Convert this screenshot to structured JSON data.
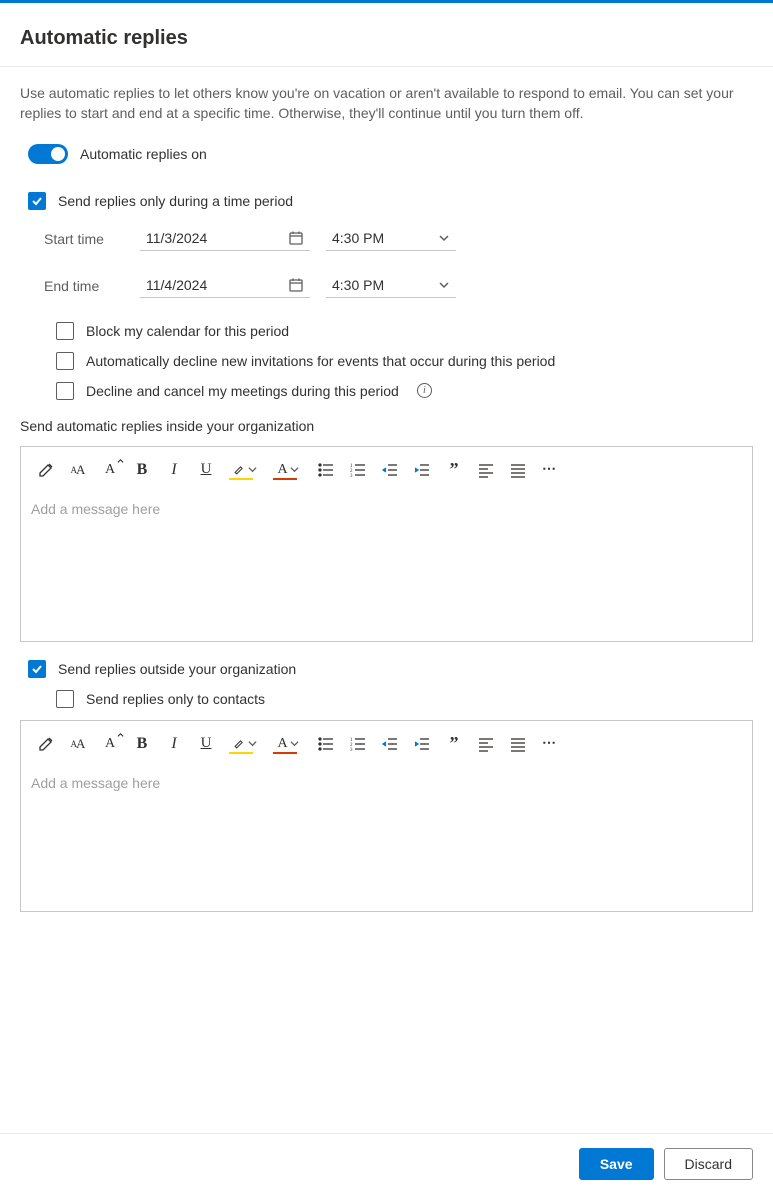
{
  "title": "Automatic replies",
  "description": "Use automatic replies to let others know you're on vacation or aren't available to respond to email. You can set your replies to start and end at a specific time. Otherwise, they'll continue until you turn them off.",
  "toggle": {
    "label": "Automatic replies on",
    "on": true
  },
  "timePeriod": {
    "sendOnlyPeriod": {
      "label": "Send replies only during a time period",
      "checked": true
    },
    "startLabel": "Start time",
    "endLabel": "End time",
    "startDate": "11/3/2024",
    "startTime": "4:30 PM",
    "endDate": "11/4/2024",
    "endTime": "4:30 PM",
    "blockCalendar": {
      "label": "Block my calendar for this period",
      "checked": false
    },
    "declineNew": {
      "label": "Automatically decline new invitations for events that occur during this period",
      "checked": false
    },
    "declineCancel": {
      "label": "Decline and cancel my meetings during this period",
      "checked": false
    }
  },
  "internal": {
    "sectionLabel": "Send automatic replies inside your organization",
    "placeholder": "Add a message here"
  },
  "external": {
    "sendOutside": {
      "label": "Send replies outside your organization",
      "checked": true
    },
    "contactsOnly": {
      "label": "Send replies only to contacts",
      "checked": false
    },
    "placeholder": "Add a message here"
  },
  "toolbarIcons": {
    "painter": "format-painter-icon",
    "font": "font-icon",
    "fontSize": "font-size-icon",
    "bold": "B",
    "italic": "I",
    "underline": "U",
    "highlight": "highlight-icon",
    "fontColor": "font-color-icon",
    "bullets": "bullet-list-icon",
    "numbers": "numbered-list-icon",
    "outdent": "decrease-indent-icon",
    "indent": "increase-indent-icon",
    "quote": "quote-icon",
    "alignLeft": "align-left-icon",
    "alignJustify": "align-justify-icon",
    "more": "more-icon"
  },
  "footer": {
    "save": "Save",
    "discard": "Discard"
  }
}
